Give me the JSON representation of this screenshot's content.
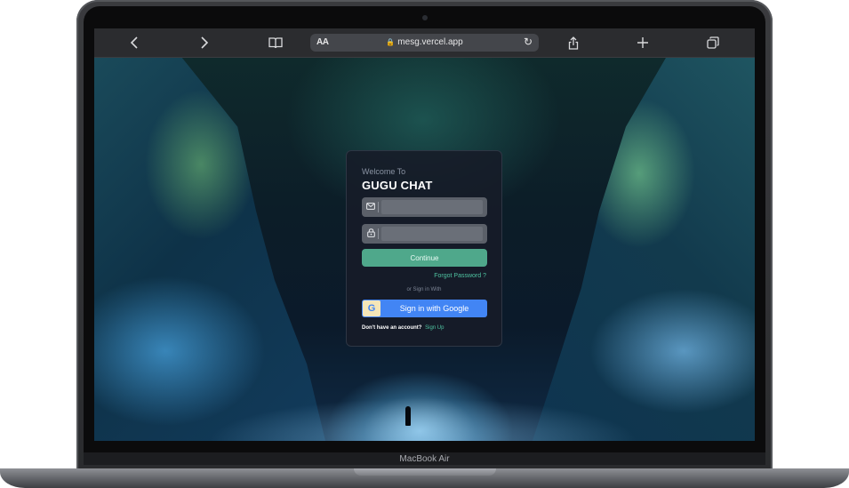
{
  "device": {
    "brand_label": "MacBook Air"
  },
  "browser": {
    "text_size_label": "AA",
    "url": "mesg.vercel.app",
    "icons": [
      "back-icon",
      "forward-icon",
      "bookmarks-icon",
      "lock-icon",
      "reload-icon",
      "share-icon",
      "new-tab-icon",
      "tabs-icon"
    ]
  },
  "login": {
    "welcome": "Welcome To",
    "title": "GUGU CHAT",
    "email": {
      "value": "",
      "placeholder": "",
      "icon": "mail-icon"
    },
    "password": {
      "value": "",
      "placeholder": "",
      "icon": "lock-icon"
    },
    "continue_label": "Continue",
    "forgot_label": "Forgot Password ?",
    "or_text": "or Sign in With",
    "google_label": "Sign in with Google",
    "google_icon_letter": "G",
    "no_account_text": "Don't have an account?",
    "signup_label": "Sign Up"
  },
  "colors": {
    "accent": "#4fa88b",
    "link": "#4fc3a1",
    "google_blue": "#4285f4",
    "card_bg": "#161c28"
  }
}
